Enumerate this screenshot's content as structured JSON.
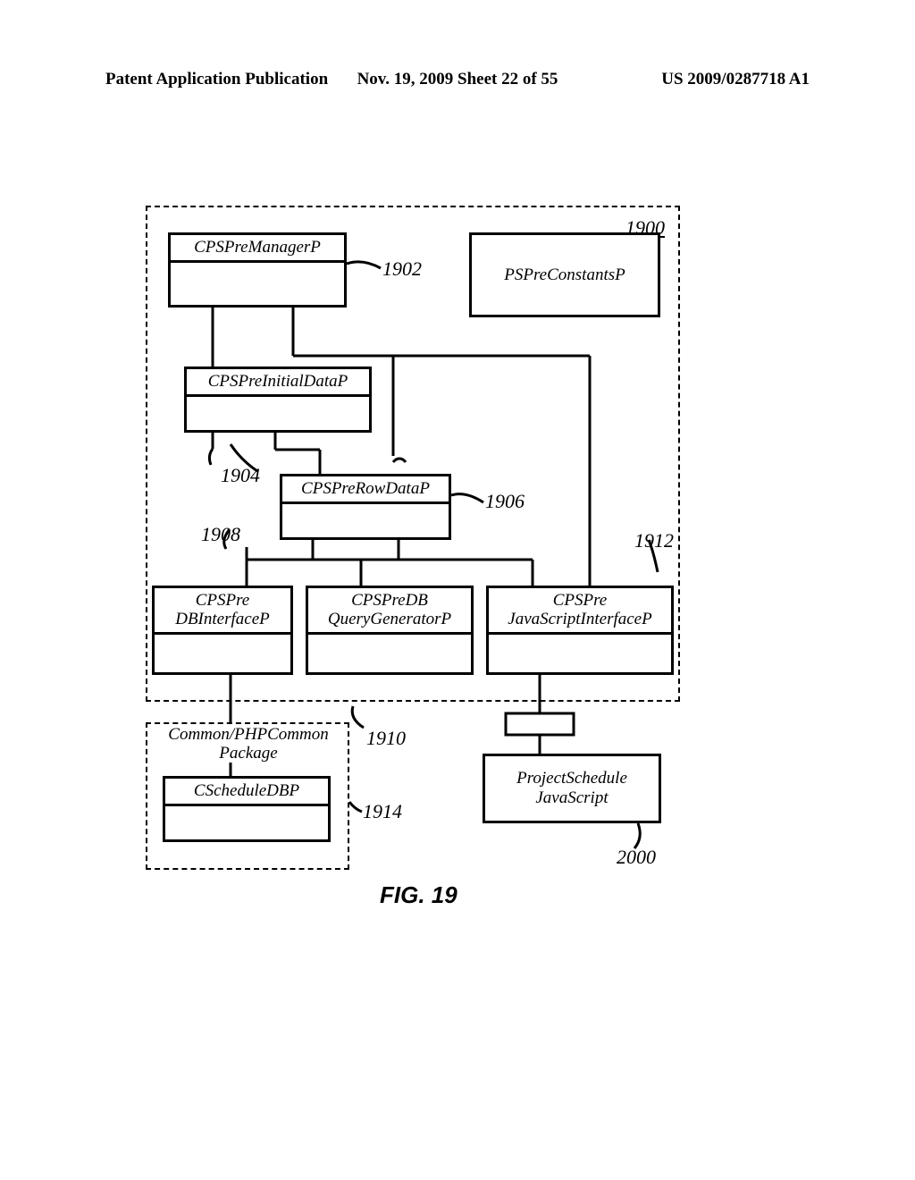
{
  "header": {
    "left": "Patent Application Publication",
    "center": "Nov. 19, 2009  Sheet 22 of 55",
    "right": "US 2009/0287718 A1"
  },
  "group_1900": {
    "ref": "1900"
  },
  "classes": {
    "manager": {
      "name": "CPSPreManagerP",
      "ref": "1902"
    },
    "constants": {
      "name": "PSPreConstantsP"
    },
    "initial": {
      "name": "CPSPreInitialDataP",
      "ref": "1904"
    },
    "rowdata": {
      "name": "CPSPreRowDataP",
      "ref": "1906"
    },
    "dbint": {
      "line1": "CPSPre",
      "line2": "DBInterfaceP",
      "ref": "1908"
    },
    "querygen": {
      "line1": "CPSPreDB",
      "line2": "QueryGeneratorP",
      "ref": "1910"
    },
    "jsint": {
      "line1": "CPSPre",
      "line2": "JavaScriptInterfaceP",
      "ref": "1912"
    },
    "common": {
      "title_line1": "Common/PHPCommon",
      "title_line2": "Package",
      "child": "CScheduleDBP",
      "ref": "1914"
    },
    "psjs": {
      "line1": "ProjectSchedule",
      "line2": "JavaScript",
      "ref": "2000"
    }
  },
  "figure_caption": "FIG.  19"
}
